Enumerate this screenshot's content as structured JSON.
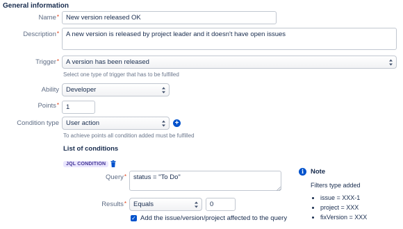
{
  "section_title": "General information",
  "name": {
    "label": "Name",
    "value": "New version released OK"
  },
  "description": {
    "label": "Description",
    "value": "A new version is released by project leader and it doesn't have open issues"
  },
  "trigger": {
    "label": "Trigger",
    "value": "A version has been released",
    "help": "Select one type of trigger that has to be fulfilled"
  },
  "ability": {
    "label": "Ability",
    "value": "Developer"
  },
  "points": {
    "label": "Points",
    "value": "1"
  },
  "condition_type": {
    "label": "Condition type",
    "value": "User action",
    "help": "To achieve points all condition added must be fulfilled"
  },
  "conditions": {
    "heading": "List of conditions",
    "badge": "JQL CONDITION",
    "query": {
      "label": "Query",
      "value": "status = \"To Do\""
    },
    "results": {
      "label": "Results",
      "operator": "Equals",
      "value": "0"
    },
    "add_affected_label": "Add the issue/version/project affected to the query"
  },
  "note": {
    "title": "Note",
    "text": "Filters type added",
    "items": [
      "issue = XXX-1",
      "project = XXX",
      "fixVersion = XXX"
    ]
  },
  "colors": {
    "required": "#de350b",
    "accent": "#0052cc",
    "badge_bg": "#eae6ff"
  },
  "icons": [
    "trash-icon",
    "add-condition-icon",
    "info-icon",
    "checkbox-checked-icon",
    "select-caret-icon"
  ]
}
